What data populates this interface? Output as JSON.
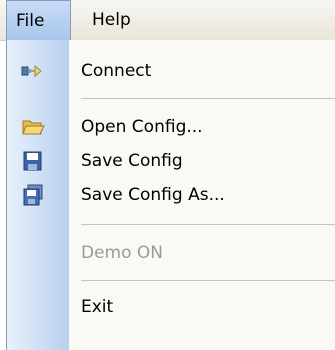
{
  "menubar": {
    "items": [
      {
        "label": "File"
      },
      {
        "label": "Help"
      }
    ]
  },
  "file_menu": {
    "items": [
      {
        "label": "Connect",
        "icon": "connect-icon",
        "enabled": true
      },
      {
        "label": "Open Config...",
        "icon": "open-folder-icon",
        "enabled": true
      },
      {
        "label": "Save Config",
        "icon": "save-icon",
        "enabled": true
      },
      {
        "label": "Save Config As...",
        "icon": "save-as-icon",
        "enabled": true
      },
      {
        "label": "Demo ON",
        "enabled": false
      },
      {
        "label": "Exit",
        "enabled": true
      }
    ]
  },
  "colors": {
    "accent": "#a8c6ec",
    "gutter": "#cddff5",
    "disabled_text": "#9a9a9a"
  }
}
